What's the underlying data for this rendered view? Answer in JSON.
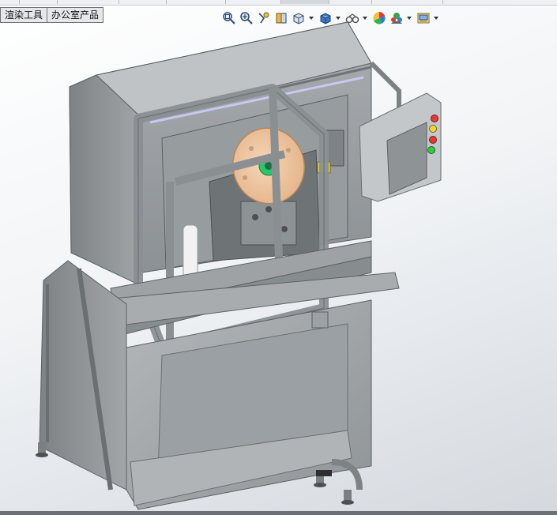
{
  "tabs": [
    {
      "label": "渲染工具"
    },
    {
      "label": "办公室产品"
    }
  ],
  "toolbar": {
    "icons": [
      "zoom-to-fit-icon",
      "zoom-area-icon",
      "previous-view-icon",
      "section-view-icon",
      "view-orientation-icon",
      "display-style-icon",
      "hide-show-items-icon",
      "edit-appearance-icon",
      "apply-scene-icon",
      "view-settings-icon"
    ]
  },
  "colors": {
    "frame": "#8e9396",
    "frame_dark": "#5c6165",
    "frame_light": "#b9bdbf",
    "spool": "#f1c9a4",
    "accent_green": "#29c76b",
    "button_red": "#e53935",
    "button_yellow": "#f2d43a",
    "button_green": "#35c845"
  }
}
